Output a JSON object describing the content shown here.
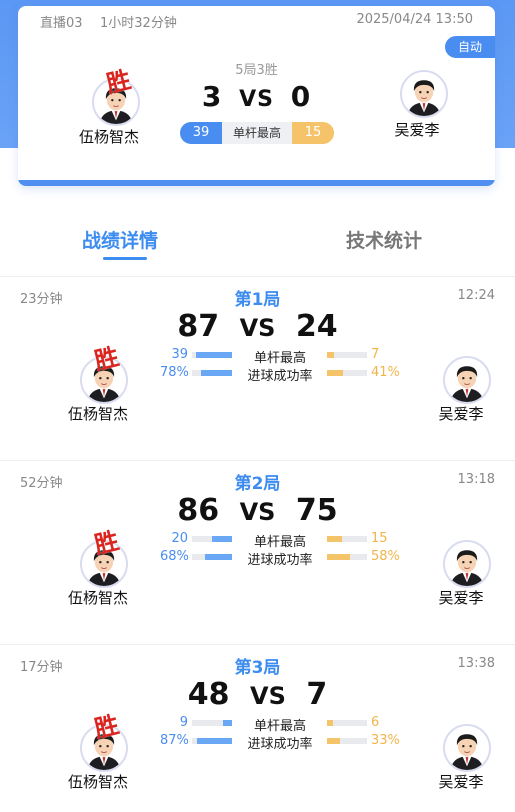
{
  "summary": {
    "room": "直播03",
    "duration": "1小时32分钟",
    "datetime": "2025/04/24 13:50",
    "auto_label": "自动",
    "format": "5局3胜",
    "score_left": "3",
    "vs": "VS",
    "score_right": "0",
    "highest_break": {
      "left": "39",
      "label": "单杆最高",
      "right": "15"
    }
  },
  "players": {
    "left": {
      "name": "伍杨智杰",
      "win_mark": "胜"
    },
    "right": {
      "name": "吴爱李"
    }
  },
  "tabs": [
    {
      "label": "战绩详情",
      "active": true
    },
    {
      "label": "技术统计",
      "active": false
    }
  ],
  "games": [
    {
      "duration": "23分钟",
      "title": "第1局",
      "time": "12:24",
      "score_left": "87",
      "vs": "VS",
      "score_right": "24",
      "win_mark": "胜",
      "left_name": "伍杨智杰",
      "right_name": "吴爱李",
      "stats": [
        {
          "label": "单杆最高",
          "left": "39",
          "right": "7",
          "left_fill": 0.9,
          "right_fill": 0.17
        },
        {
          "label": "进球成功率",
          "left": "78%",
          "right": "41%",
          "left_fill": 0.78,
          "right_fill": 0.41
        }
      ]
    },
    {
      "duration": "52分钟",
      "title": "第2局",
      "time": "13:18",
      "score_left": "86",
      "vs": "VS",
      "score_right": "75",
      "win_mark": "胜",
      "left_name": "伍杨智杰",
      "right_name": "吴爱李",
      "stats": [
        {
          "label": "单杆最高",
          "left": "20",
          "right": "15",
          "left_fill": 0.5,
          "right_fill": 0.38
        },
        {
          "label": "进球成功率",
          "left": "68%",
          "right": "58%",
          "left_fill": 0.68,
          "right_fill": 0.58
        }
      ]
    },
    {
      "duration": "17分钟",
      "title": "第3局",
      "time": "13:38",
      "score_left": "48",
      "vs": "VS",
      "score_right": "7",
      "win_mark": "胜",
      "left_name": "伍杨智杰",
      "right_name": "吴爱李",
      "stats": [
        {
          "label": "单杆最高",
          "left": "9",
          "right": "6",
          "left_fill": 0.23,
          "right_fill": 0.15
        },
        {
          "label": "进球成功率",
          "left": "87%",
          "right": "33%",
          "left_fill": 0.87,
          "right_fill": 0.33
        }
      ]
    }
  ],
  "colors": {
    "accent": "#3d8cf0",
    "accent_dark": "#4a8df0",
    "gold": "#f5c36a",
    "win_red": "#d9251d"
  },
  "icons": {
    "avatar": "cartoon-player-avatar-icon"
  }
}
